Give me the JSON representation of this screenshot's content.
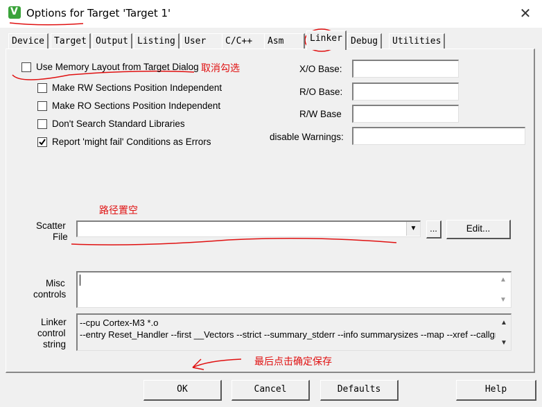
{
  "window": {
    "title": "Options for Target 'Target 1'",
    "close_glyph": "✕"
  },
  "tabs": [
    {
      "label": "Device"
    },
    {
      "label": "Target"
    },
    {
      "label": "Output"
    },
    {
      "label": "Listing"
    },
    {
      "label": "User"
    },
    {
      "label": "C/C++"
    },
    {
      "label": "Asm"
    },
    {
      "label": "Linker",
      "active": true
    },
    {
      "label": "Debug"
    },
    {
      "label": "Utilities"
    }
  ],
  "linker": {
    "use_memory_layout": {
      "label": "Use Memory Layout from Target Dialog",
      "checked": false
    },
    "make_rw": {
      "label": "Make RW Sections Position Independent",
      "checked": false
    },
    "make_ro": {
      "label": "Make RO Sections Position Independent",
      "checked": false
    },
    "dont_search": {
      "label": "Don't Search Standard Libraries",
      "checked": false
    },
    "report_might_fail": {
      "label": "Report 'might fail' Conditions as Errors",
      "checked": true
    },
    "xo_base": {
      "label": "X/O Base:",
      "value": ""
    },
    "ro_base": {
      "label": "R/O Base:",
      "value": ""
    },
    "rw_base": {
      "label": "R/W Base",
      "value": ""
    },
    "disable_warnings": {
      "label": "disable Warnings:",
      "value": ""
    },
    "scatter_file": {
      "label_line1": "Scatter",
      "label_line2": "File",
      "value": "",
      "browse": "...",
      "edit": "Edit..."
    },
    "misc_controls": {
      "label_line1": "Misc",
      "label_line2": "controls",
      "value": ""
    },
    "linker_control_string": {
      "label_line1": "Linker",
      "label_line2": "control",
      "label_line3": "string",
      "line1": "--cpu Cortex-M3 *.o",
      "line2": "--entry Reset_Handler --first __Vectors --strict --summary_stderr --info summarysizes --map --xref --callgra"
    }
  },
  "annotations": {
    "uncheck": "取消勾选",
    "clear_path": "路径置空",
    "confirm_save": "最后点击确定保存",
    "color": "#e01010"
  },
  "footer": {
    "ok": "OK",
    "cancel": "Cancel",
    "defaults": "Defaults",
    "help": "Help"
  }
}
